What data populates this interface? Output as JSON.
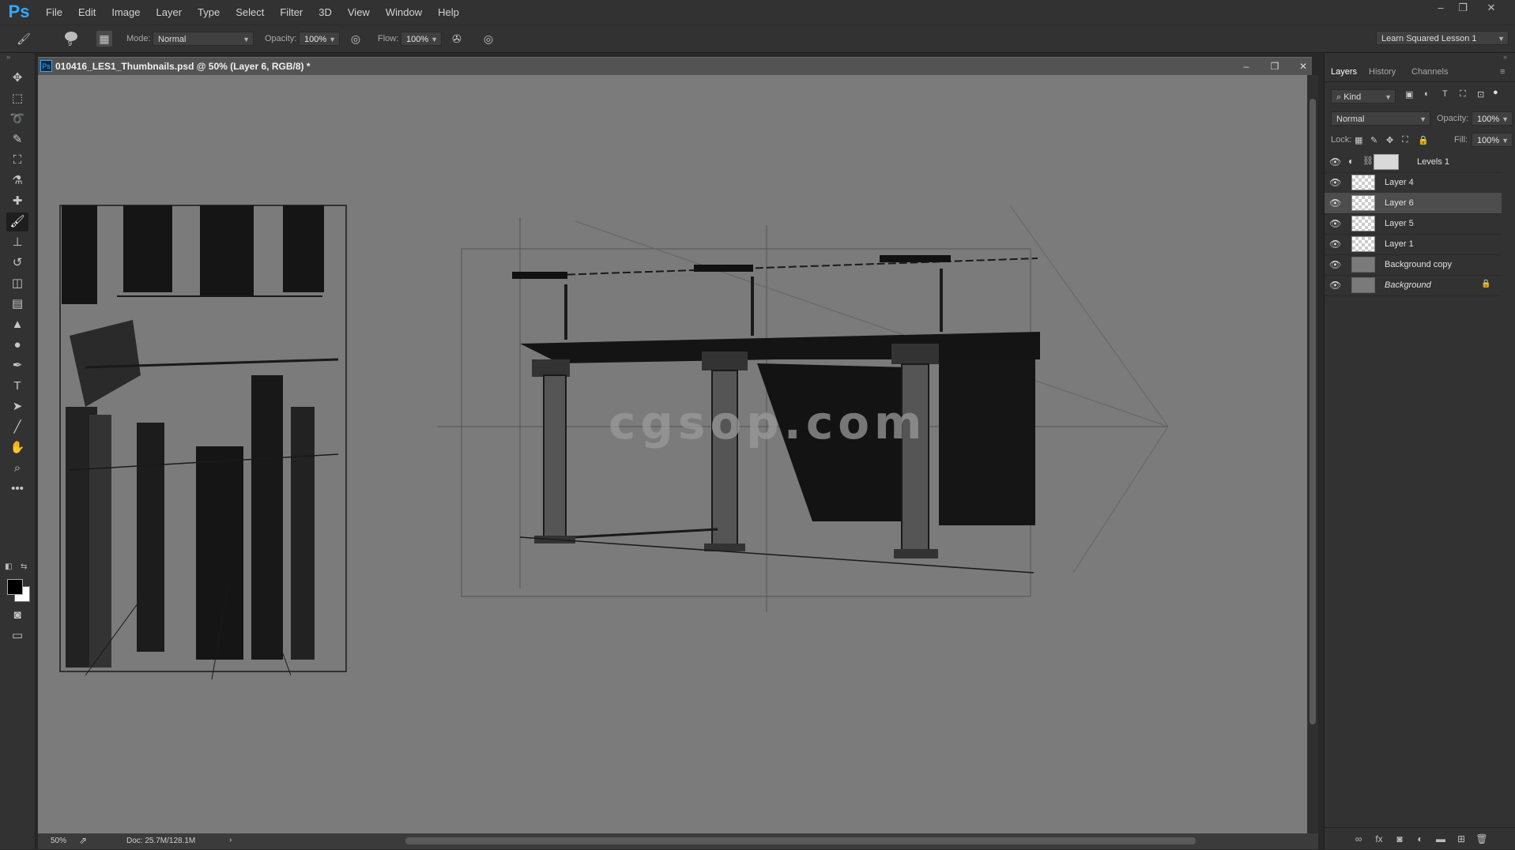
{
  "app": {
    "logo": "Ps"
  },
  "menu": [
    "File",
    "Edit",
    "Image",
    "Layer",
    "Type",
    "Select",
    "Filter",
    "3D",
    "View",
    "Window",
    "Help"
  ],
  "window_controls": {
    "minimize": "–",
    "restore": "❐",
    "close": "✕"
  },
  "options_bar": {
    "brush_size": "9",
    "mode_label": "Mode:",
    "mode_value": "Normal",
    "opacity_label": "Opacity:",
    "opacity_value": "100%",
    "flow_label": "Flow:",
    "flow_value": "100%",
    "workspace": "Learn Squared Lesson 1"
  },
  "tools": [
    {
      "name": "move-tool",
      "glyph": "✥"
    },
    {
      "name": "marquee-tool",
      "glyph": "⬚"
    },
    {
      "name": "lasso-tool",
      "glyph": "➰"
    },
    {
      "name": "quick-select-tool",
      "glyph": "✎"
    },
    {
      "name": "crop-tool",
      "glyph": "⛶"
    },
    {
      "name": "eyedropper-tool",
      "glyph": "⚗"
    },
    {
      "name": "healing-brush-tool",
      "glyph": "✚"
    },
    {
      "name": "brush-tool",
      "glyph": "🖌"
    },
    {
      "name": "stamp-tool",
      "glyph": "⊥"
    },
    {
      "name": "history-brush-tool",
      "glyph": "↺"
    },
    {
      "name": "eraser-tool",
      "glyph": "◫"
    },
    {
      "name": "gradient-tool",
      "glyph": "▤"
    },
    {
      "name": "blur-tool",
      "glyph": "▲"
    },
    {
      "name": "dodge-tool",
      "glyph": "●"
    },
    {
      "name": "pen-tool",
      "glyph": "✒"
    },
    {
      "name": "type-tool",
      "glyph": "T"
    },
    {
      "name": "path-select-tool",
      "glyph": "➤"
    },
    {
      "name": "line-tool",
      "glyph": "╱"
    },
    {
      "name": "hand-tool",
      "glyph": "✋"
    },
    {
      "name": "zoom-tool",
      "glyph": "⌕"
    },
    {
      "name": "more-tools",
      "glyph": "•••"
    }
  ],
  "document": {
    "title": "010416_LES1_Thumbnails.psd @ 50% (Layer 6, RGB/8) *",
    "zoom": "50%",
    "doc_size": "Doc: 25.7M/128.1M",
    "watermark": "cgsop.com"
  },
  "panel": {
    "tabs": [
      "Layers",
      "History",
      "Channels"
    ],
    "filter": "Kind",
    "blend_mode": "Normal",
    "opacity_label": "Opacity:",
    "opacity_value": "100%",
    "lock_label": "Lock:",
    "fill_label": "Fill:",
    "fill_value": "100%",
    "layers": [
      {
        "name": "Levels 1",
        "type": "adjustment"
      },
      {
        "name": "Layer 4",
        "type": "pixel"
      },
      {
        "name": "Layer 6",
        "type": "pixel",
        "selected": true
      },
      {
        "name": "Layer 5",
        "type": "pixel"
      },
      {
        "name": "Layer 1",
        "type": "pixel"
      },
      {
        "name": "Background copy",
        "type": "fill"
      },
      {
        "name": "Background",
        "type": "fill",
        "locked": true
      }
    ]
  }
}
